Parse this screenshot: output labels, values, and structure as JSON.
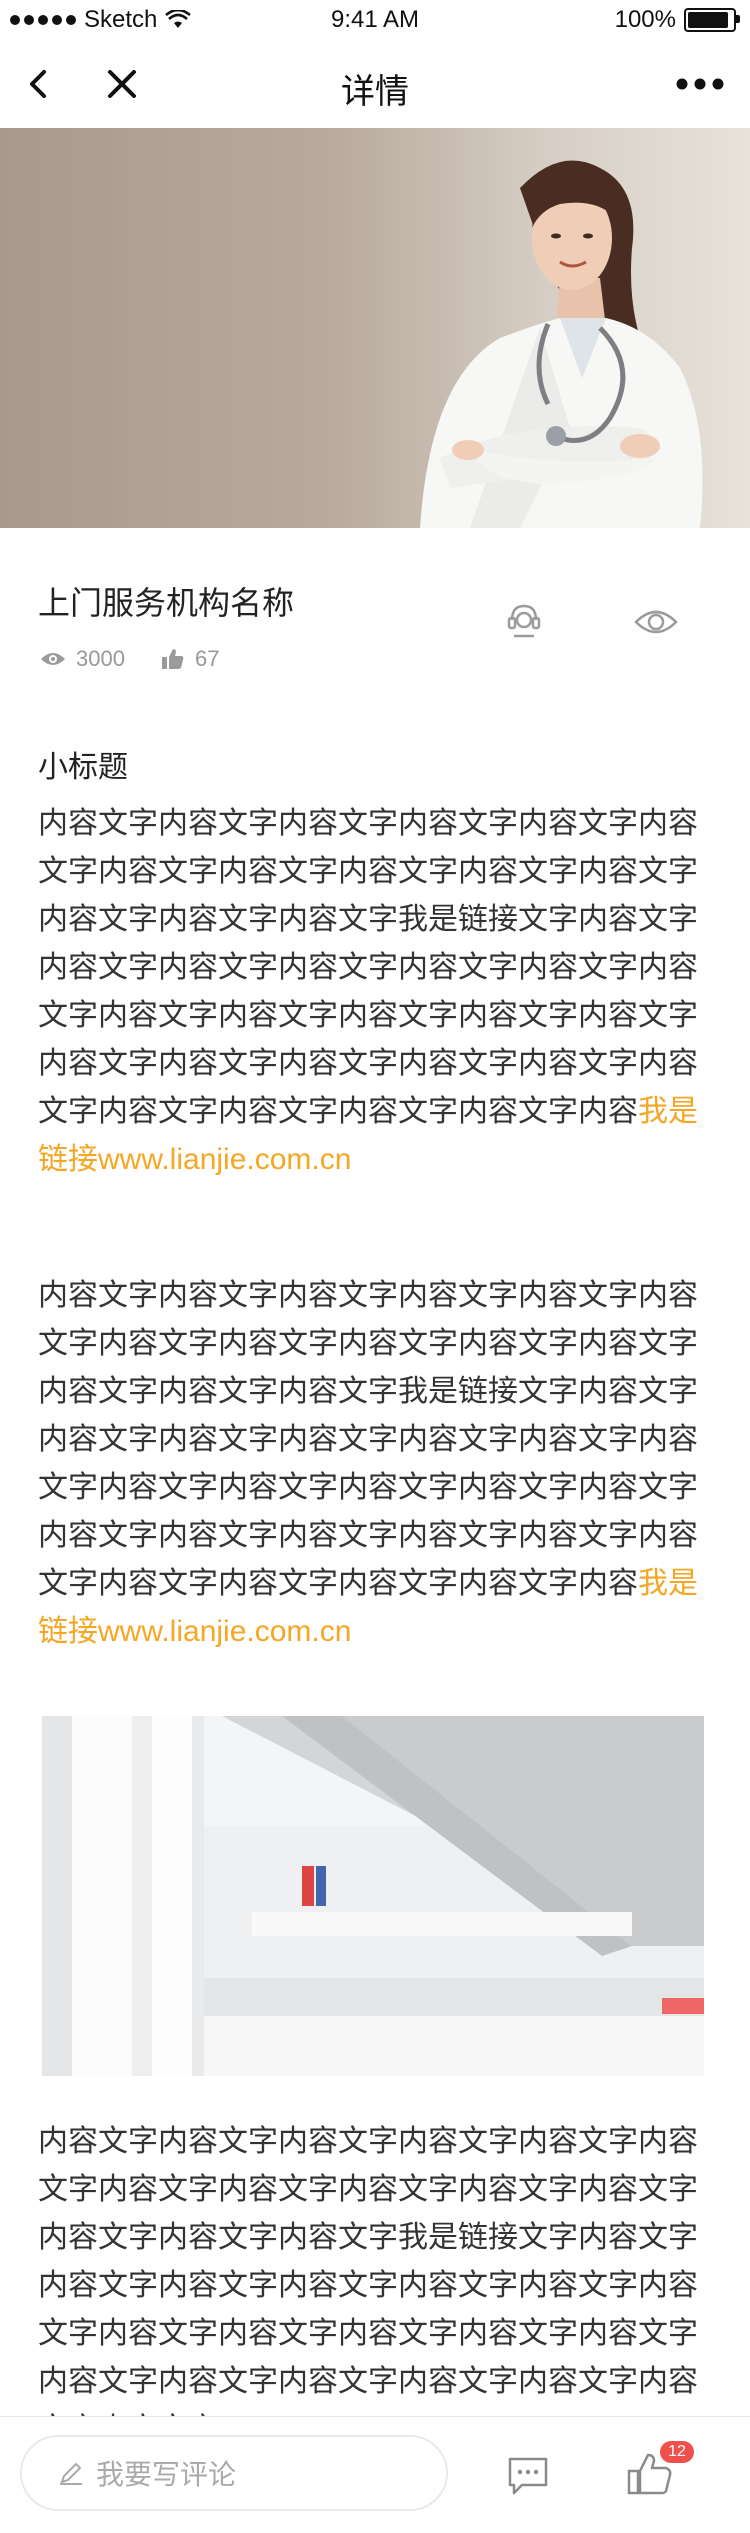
{
  "status_bar": {
    "carrier": "Sketch",
    "time": "9:41 AM",
    "battery": "100%",
    "battery_level": 1.0
  },
  "nav": {
    "title": "详情",
    "icons": [
      "back-icon",
      "close-icon",
      "more-icon"
    ]
  },
  "info": {
    "org_name": "上门服务机构名称",
    "views": "3000",
    "likes": "67",
    "icons": [
      "eye-icon",
      "thumb-up-icon",
      "customer-service-icon",
      "view-icon"
    ]
  },
  "content": {
    "subtitle": "小标题",
    "p1_text": "内容文字内容文字内容文字内容文字内容文字内容文字内容文字内容文字内容文字内容文字内容文字内容文字内容文字内容文字我是链接文字内容文字内容文字内容文字内容文字内容文字内容文字内容文字内容文字内容文字内容文字内容文字内容文字内容文字内容文字内容文字内容文字内容文字内容文字内容文字内容文字内容文字内容文字内容",
    "p1_link": "我是链接www.lianjie.com.cn",
    "p2_text": "内容文字内容文字内容文字内容文字内容文字内容文字内容文字内容文字内容文字内容文字内容文字内容文字内容文字内容文字我是链接文字内容文字内容文字内容文字内容文字内容文字内容文字内容文字内容文字内容文字内容文字内容文字内容文字内容文字内容文字内容文字内容文字内容文字内容文字内容文字内容文字内容文字内容文字内容",
    "p2_link": "我是链接www.lianjie.com.cn",
    "p3_text": "内容文字内容文字内容文字内容文字内容文字内容文字内容文字内容文字内容文字内容文字内容文字内容文字内容文字内容文字我是链接文字内容文字内容文字内容文字内容文字内容文字内容文字内容文字内容文字内容文字内容文字内容文字内容文字内容文字内容文字内容文字内容文字内容文字内容文字内容文字"
  },
  "bottom_bar": {
    "comment_placeholder": "我要写评论",
    "like_count": "12",
    "icons": [
      "pencil-icon",
      "chat-icon",
      "thumb-up-icon"
    ]
  },
  "colors": {
    "link": "#f5a623",
    "badge": "#f0504b",
    "hero_bg": "#b9aa9e"
  }
}
